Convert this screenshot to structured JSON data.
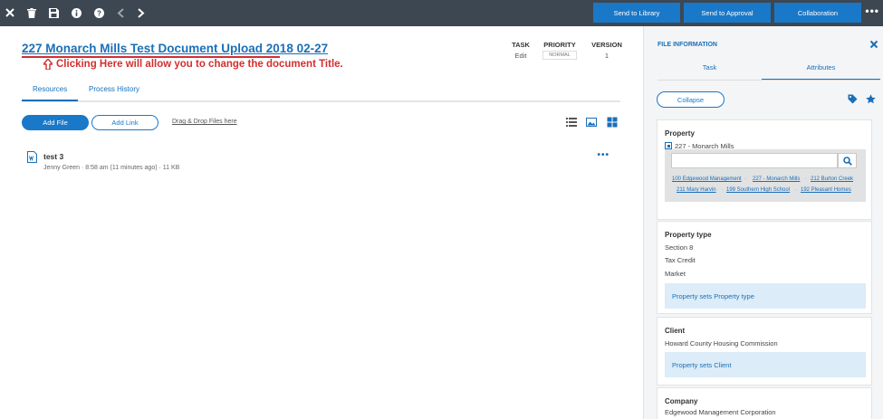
{
  "toolbar": {
    "icons": [
      "close-icon",
      "trash-icon",
      "save-icon",
      "info-icon",
      "help-icon",
      "back-icon",
      "forward-icon"
    ],
    "buttons": {
      "send_library": "Send to Library",
      "send_approval": "Send to Approval",
      "collaboration": "Collaboration"
    },
    "more": "•••"
  },
  "document": {
    "title": "227 Monarch Mills Test Document Upload 2018 02-27",
    "annotation": "Clicking Here will allow you to change the document Title."
  },
  "meta": {
    "task_label": "TASK",
    "task_value": "Edit",
    "priority_label": "PRIORITY",
    "priority_value": "NORMAL",
    "version_label": "VERSION",
    "version_value": "1"
  },
  "tabs": {
    "resources": "Resources",
    "process_history": "Process History"
  },
  "actions": {
    "add_file": "Add File",
    "add_link": "Add Link",
    "drag_drop": "Drag & Drop Files here"
  },
  "files": [
    {
      "name": "test 3",
      "meta": "Jenny Green · 8:58 am (11 minutes ago) · 11 KB",
      "more": "•••"
    }
  ],
  "panel": {
    "title": "FILE INFORMATION",
    "tab_task": "Task",
    "tab_attributes": "Attributes",
    "collapse": "Collapse",
    "property": {
      "heading": "Property",
      "selected": "227 - Monarch Mills",
      "search_placeholder": "",
      "suggestions_row1": [
        "100 Edgewood Management",
        "227 - Monarch Mills",
        "212 Burton Creek"
      ],
      "suggestions_row2": [
        "211 Mary Harvin",
        "199 Southern High School",
        "192 Pleasant Homes"
      ]
    },
    "property_type": {
      "heading": "Property type",
      "options": [
        "Section 8",
        "Tax Credit",
        "Market"
      ],
      "note": "Property sets Property type"
    },
    "client": {
      "heading": "Client",
      "value": "Howard County Housing Commission",
      "note": "Property sets Client"
    },
    "company": {
      "heading": "Company",
      "value": "Edgewood Management Corporation"
    }
  },
  "colors": {
    "toolbar_bg": "#3d4752",
    "accent": "#1a78c8",
    "link": "#1a6fb8",
    "annotation": "#d32f2f",
    "note_bg": "#dcecf8"
  }
}
